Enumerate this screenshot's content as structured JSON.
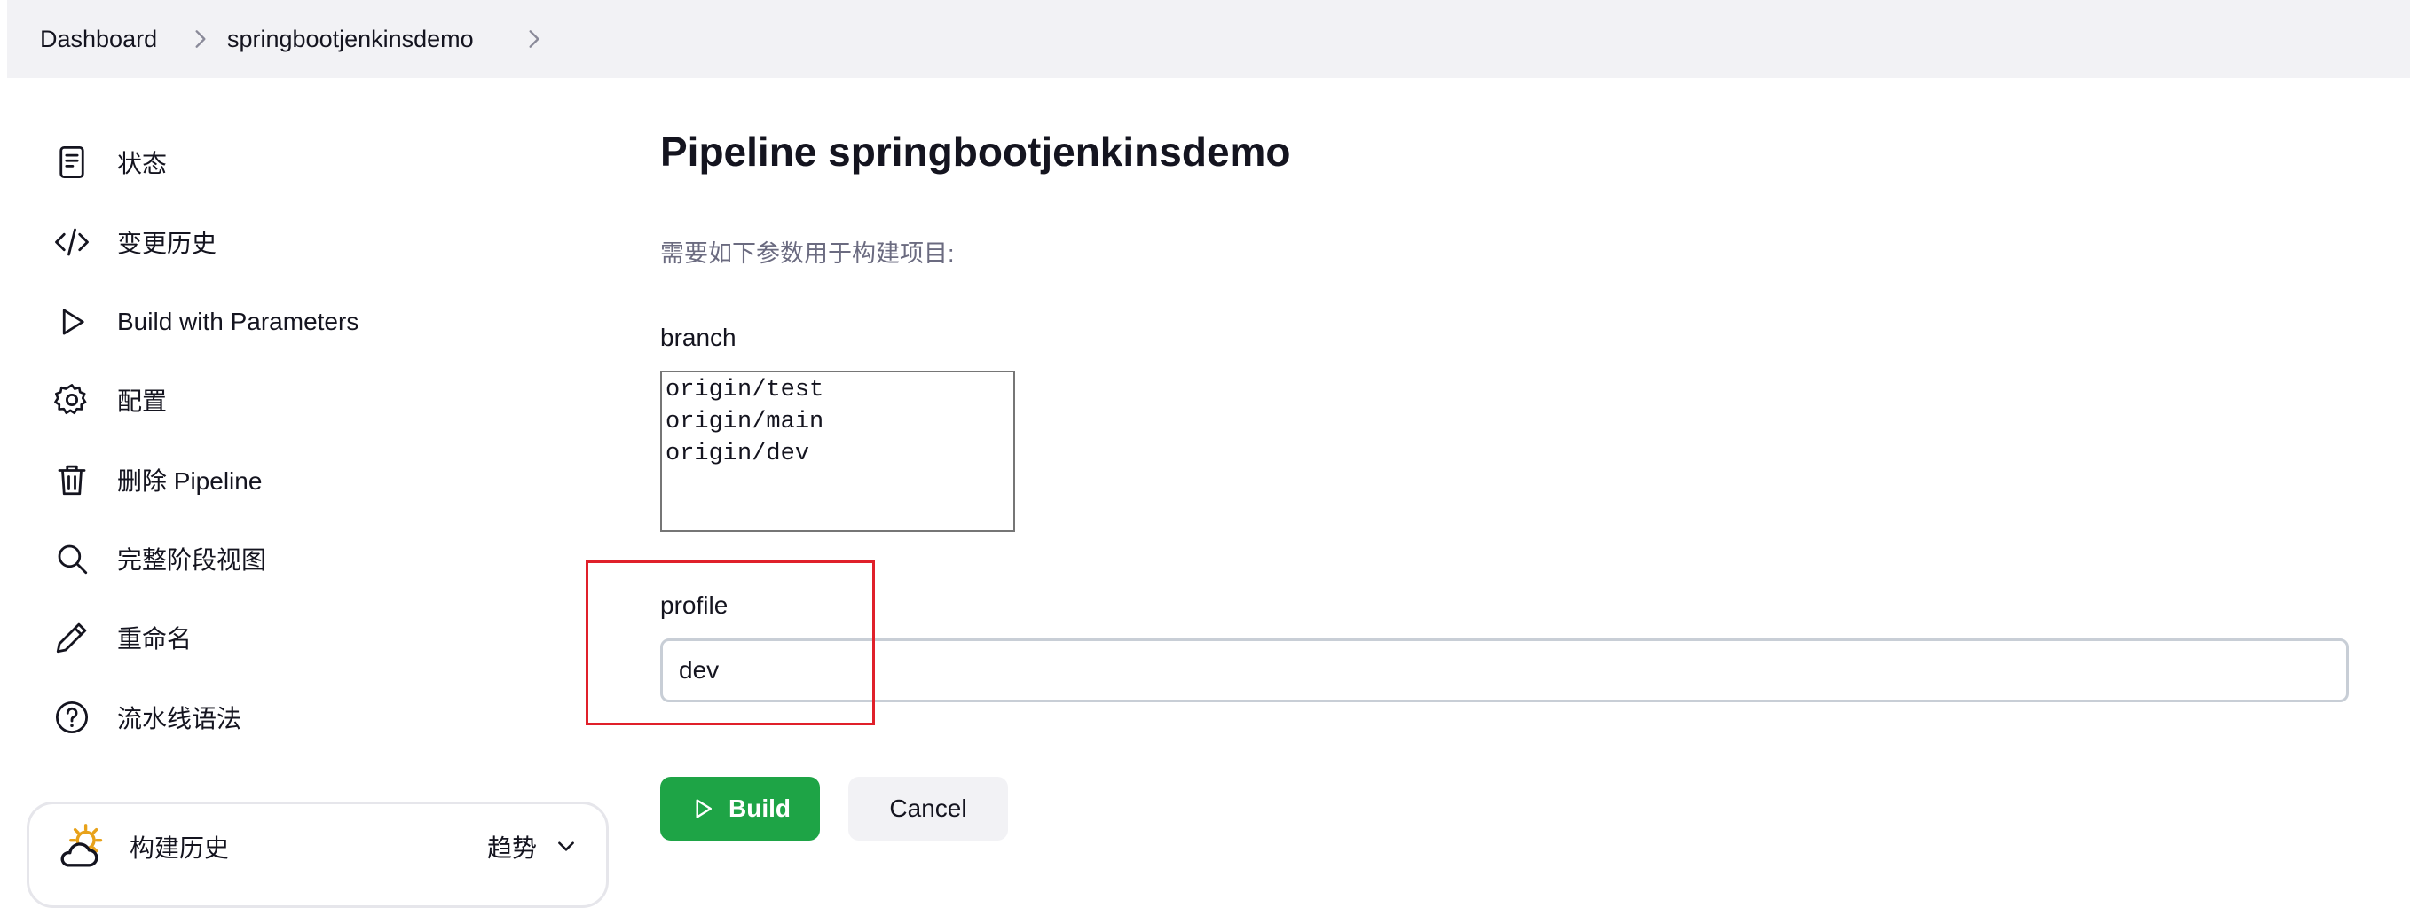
{
  "breadcrumb": {
    "items": [
      "Dashboard",
      "springbootjenkinsdemo"
    ]
  },
  "sidebar": {
    "items": [
      {
        "label": "状态",
        "icon": "document-icon"
      },
      {
        "label": "变更历史",
        "icon": "code-icon"
      },
      {
        "label": "Build with Parameters",
        "icon": "play-icon"
      },
      {
        "label": "配置",
        "icon": "gear-icon"
      },
      {
        "label": "删除 Pipeline",
        "icon": "trash-icon"
      },
      {
        "label": "完整阶段视图",
        "icon": "search-icon"
      },
      {
        "label": "重命名",
        "icon": "pencil-icon"
      },
      {
        "label": "流水线语法",
        "icon": "help-icon"
      }
    ],
    "history": {
      "title": "构建历史",
      "trend_label": "趋势",
      "icon": "weather-partly-cloudy-icon"
    }
  },
  "main": {
    "title": "Pipeline springbootjenkinsdemo",
    "description": "需要如下参数用于构建项目:",
    "params": {
      "branch": {
        "name": "branch",
        "options": [
          "origin/test",
          "origin/main",
          "origin/dev"
        ]
      },
      "profile": {
        "name": "profile",
        "value": "dev"
      }
    },
    "build_label": "Build",
    "cancel_label": "Cancel"
  },
  "colors": {
    "accent": "#1ea446",
    "highlight": "#e0202a",
    "topbar": "#f2f2f5"
  }
}
